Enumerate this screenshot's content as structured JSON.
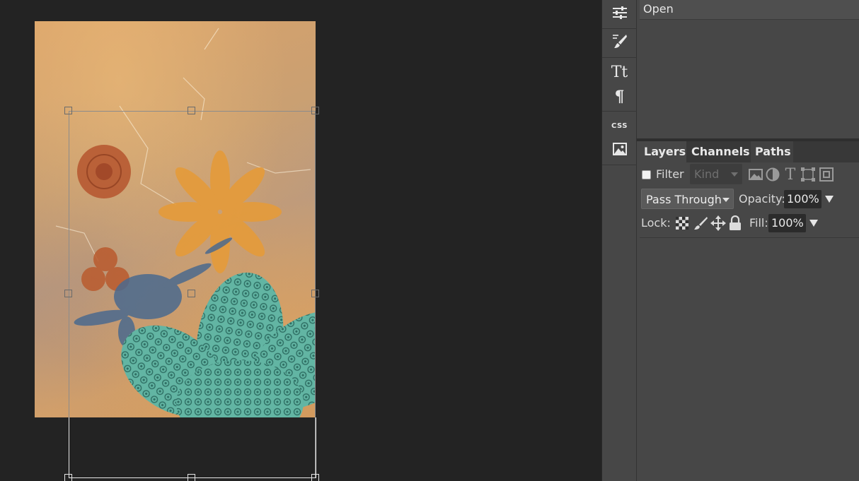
{
  "history": {
    "items": [
      {
        "label": "Open"
      }
    ]
  },
  "layers_panel": {
    "tabs": [
      {
        "label": "Layers",
        "active": true
      },
      {
        "label": "Channels",
        "active": false
      },
      {
        "label": "Paths",
        "active": false
      }
    ],
    "filter": {
      "label": "Filter",
      "checked": false,
      "kind_placeholder": "Kind"
    },
    "blend": {
      "mode": "Pass Through",
      "opacity_label": "Opacity:",
      "opacity_value": "100%"
    },
    "lock": {
      "label": "Lock:",
      "fill_label": "Fill:",
      "fill_value": "100%"
    }
  },
  "toolstrip": {
    "items": [
      {
        "icon": "adjustments-sliders-icon"
      },
      {
        "icon": "brush-settings-icon"
      },
      {
        "icon": "character-tt-icon",
        "glyph": "Tt"
      },
      {
        "icon": "paragraph-icon",
        "glyph": "¶"
      },
      {
        "icon": "css-icon",
        "glyph": "CSS"
      },
      {
        "icon": "image-icon"
      }
    ]
  },
  "colors": {
    "workspace_bg": "#232323",
    "panel_bg": "#474747",
    "tab_bar_bg": "#383838",
    "input_bg": "#2b2b2b",
    "teal_flower": "#5fb0a0"
  }
}
